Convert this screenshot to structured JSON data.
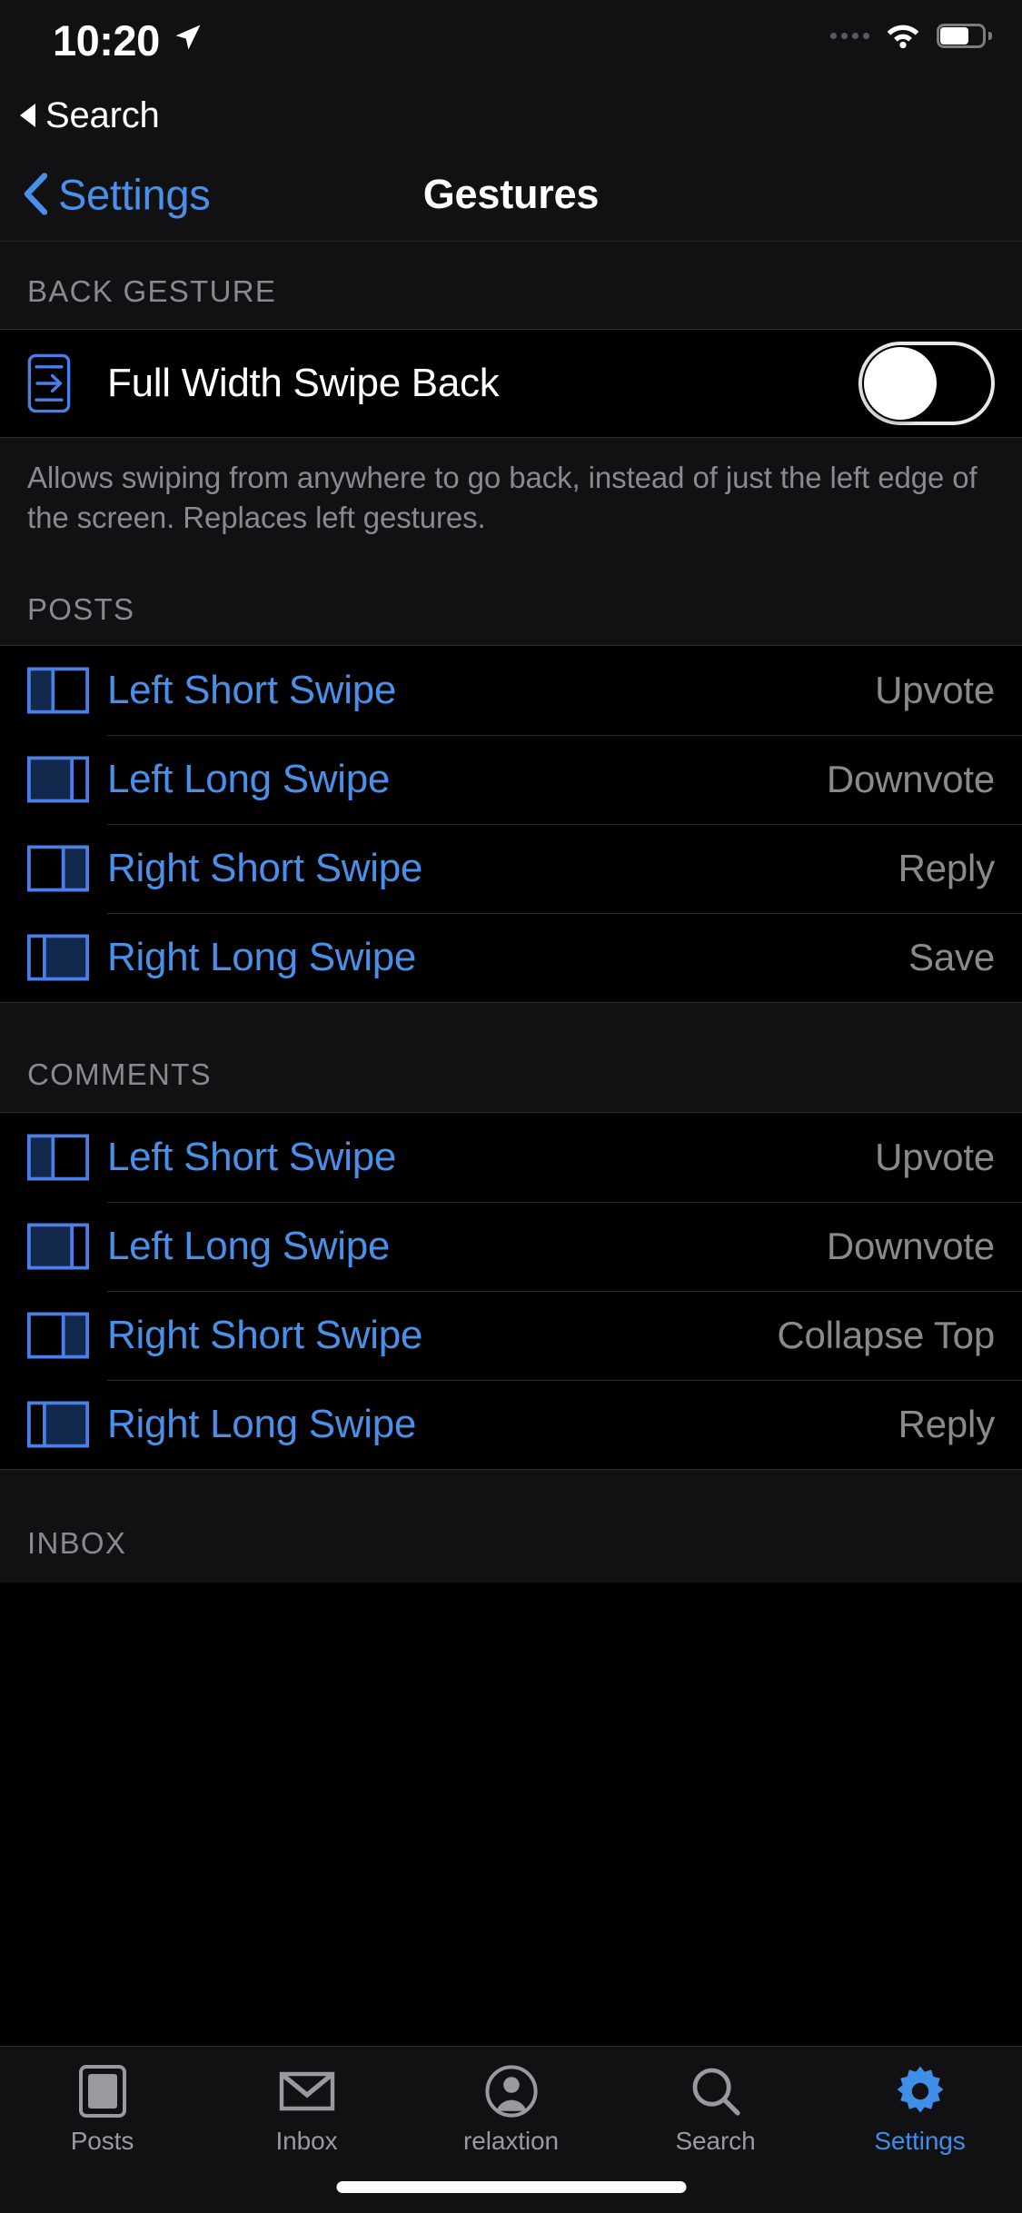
{
  "status_bar": {
    "time": "10:20",
    "location_icon": "location-arrow-icon",
    "signal_icon": "cellular-dots-icon",
    "wifi_icon": "wifi-icon",
    "battery_icon": "battery-icon"
  },
  "back_to_app": {
    "label": "Search",
    "icon": "back-triangle-icon"
  },
  "nav": {
    "back_label": "Settings",
    "back_icon": "chevron-left-icon",
    "title": "Gestures"
  },
  "sections": {
    "back_gesture": {
      "header": "BACK GESTURE",
      "row": {
        "icon": "phone-swipe-right-icon",
        "label": "Full Width Swipe Back",
        "toggle_state": "off"
      },
      "footnote": "Allows swiping from anywhere to go back, instead of just the left edge of the screen. Replaces left gestures."
    },
    "posts": {
      "header": "POSTS",
      "rows": [
        {
          "icon": "swipe-left-short-icon",
          "label": "Left Short Swipe",
          "value": "Upvote"
        },
        {
          "icon": "swipe-left-long-icon",
          "label": "Left Long Swipe",
          "value": "Downvote"
        },
        {
          "icon": "swipe-right-short-icon",
          "label": "Right Short Swipe",
          "value": "Reply"
        },
        {
          "icon": "swipe-right-long-icon",
          "label": "Right Long Swipe",
          "value": "Save"
        }
      ]
    },
    "comments": {
      "header": "COMMENTS",
      "rows": [
        {
          "icon": "swipe-left-short-icon",
          "label": "Left Short Swipe",
          "value": "Upvote"
        },
        {
          "icon": "swipe-left-long-icon",
          "label": "Left Long Swipe",
          "value": "Downvote"
        },
        {
          "icon": "swipe-right-short-icon",
          "label": "Right Short Swipe",
          "value": "Collapse Top"
        },
        {
          "icon": "swipe-right-long-icon",
          "label": "Right Long Swipe",
          "value": "Reply"
        }
      ]
    },
    "inbox": {
      "header": "INBOX"
    }
  },
  "tabbar": {
    "items": [
      {
        "label": "Posts",
        "icon": "posts-icon",
        "active": false
      },
      {
        "label": "Inbox",
        "icon": "envelope-icon",
        "active": false
      },
      {
        "label": "relaxtion",
        "icon": "account-circle-icon",
        "active": false
      },
      {
        "label": "Search",
        "icon": "search-icon",
        "active": false
      },
      {
        "label": "Settings",
        "icon": "gear-icon",
        "active": true
      }
    ]
  },
  "colors": {
    "accent_blue": "#4a90e8",
    "tab_active_blue": "#3f8ee8",
    "secondary_gray": "#8a8a8e",
    "background": "#000000",
    "chrome": "#111113",
    "separator": "#2b2b2d"
  }
}
